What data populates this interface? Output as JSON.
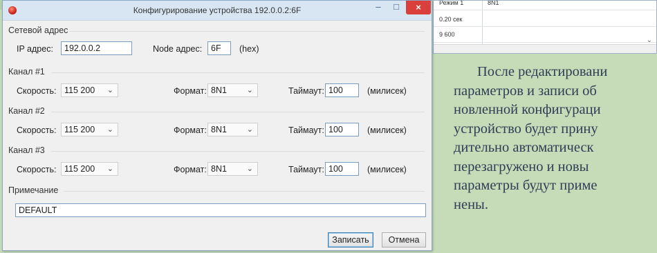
{
  "background": {
    "grid_rows": [
      "Режим 1",
      "0.20 сек",
      "9 600"
    ],
    "grid_top_cell": "8N1",
    "paragraph_lines": [
      "После   редактировани",
      "параметров  и  записи  об",
      "новленной  конфигураци",
      "устройство  будет  прину",
      "дительно     автоматическ",
      "перезагружено    и    новы",
      "параметры  будут  приме",
      "нены."
    ]
  },
  "window": {
    "title": "Конфигурирование устройства 192.0.0.2:6F",
    "minimize_glyph": "–",
    "maximize_glyph": "□",
    "close_glyph": "×"
  },
  "network": {
    "group_label": "Сетевой адрес",
    "ip_label": "IP адрес:",
    "ip_value": "192.0.0.2",
    "node_label": "Node адрес:",
    "node_value": "6F",
    "node_unit": "(hex)"
  },
  "channels": [
    {
      "group_label": "Канал #1",
      "speed_label": "Скорость:",
      "speed_value": "115 200",
      "format_label": "Формат:",
      "format_value": "8N1",
      "timeout_label": "Таймаут:",
      "timeout_value": "100",
      "timeout_unit": "(милисек)"
    },
    {
      "group_label": "Канал #2",
      "speed_label": "Скорость:",
      "speed_value": "115 200",
      "format_label": "Формат:",
      "format_value": "8N1",
      "timeout_label": "Таймаут:",
      "timeout_value": "100",
      "timeout_unit": "(милисек)"
    },
    {
      "group_label": "Канал #3",
      "speed_label": "Скорость:",
      "speed_value": "115 200",
      "format_label": "Формат:",
      "format_value": "8N1",
      "timeout_label": "Таймаут:",
      "timeout_value": "100",
      "timeout_unit": "(милисек)"
    }
  ],
  "note": {
    "group_label": "Примечание",
    "value": "DEFAULT"
  },
  "buttons": {
    "save": "Записать",
    "cancel": "Отмена"
  },
  "colors": {
    "page_background": "#c6dbb7",
    "titlebar": "#d8e6f3",
    "close_button": "#d9403b",
    "body_text": "#2f3d55"
  }
}
